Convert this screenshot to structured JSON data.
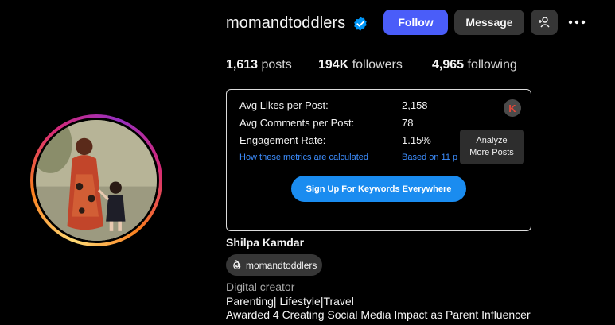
{
  "profile": {
    "username": "momandtoddlers",
    "full_name": "Shilpa Kamdar",
    "category": "Digital creator",
    "bio_lines": [
      "Parenting| Lifestyle|Travel",
      "Awarded 4 Creating Social Media Impact as Parent Influencer"
    ],
    "threads_handle": "momandtoddlers"
  },
  "actions": {
    "follow_label": "Follow",
    "message_label": "Message"
  },
  "stats": {
    "posts_count": "1,613",
    "posts_label": "posts",
    "followers_count": "194K",
    "followers_label": "followers",
    "following_count": "4,965",
    "following_label": "following"
  },
  "metrics": {
    "rows": [
      {
        "label": "Avg Likes per Post:",
        "value": "2,158"
      },
      {
        "label": "Avg Comments per Post:",
        "value": "78"
      },
      {
        "label": "Engagement Rate:",
        "value": "1.15%"
      }
    ],
    "how_link": "How these metrics are calculated",
    "based_link": "Based on 11 p",
    "analyze_line1": "Analyze",
    "analyze_line2": "More Posts",
    "signup_label": "Sign Up For Keywords Everywhere",
    "k_badge": "K"
  },
  "colors": {
    "follow_blue": "#4a5df9",
    "link_blue": "#3d8eff",
    "signup_blue": "#1a8cf0",
    "verified_blue": "#0095f6"
  },
  "icons": [
    "verified-badge-icon",
    "add-user-icon",
    "more-options-icon",
    "threads-icon",
    "keywords-everywhere-icon"
  ]
}
